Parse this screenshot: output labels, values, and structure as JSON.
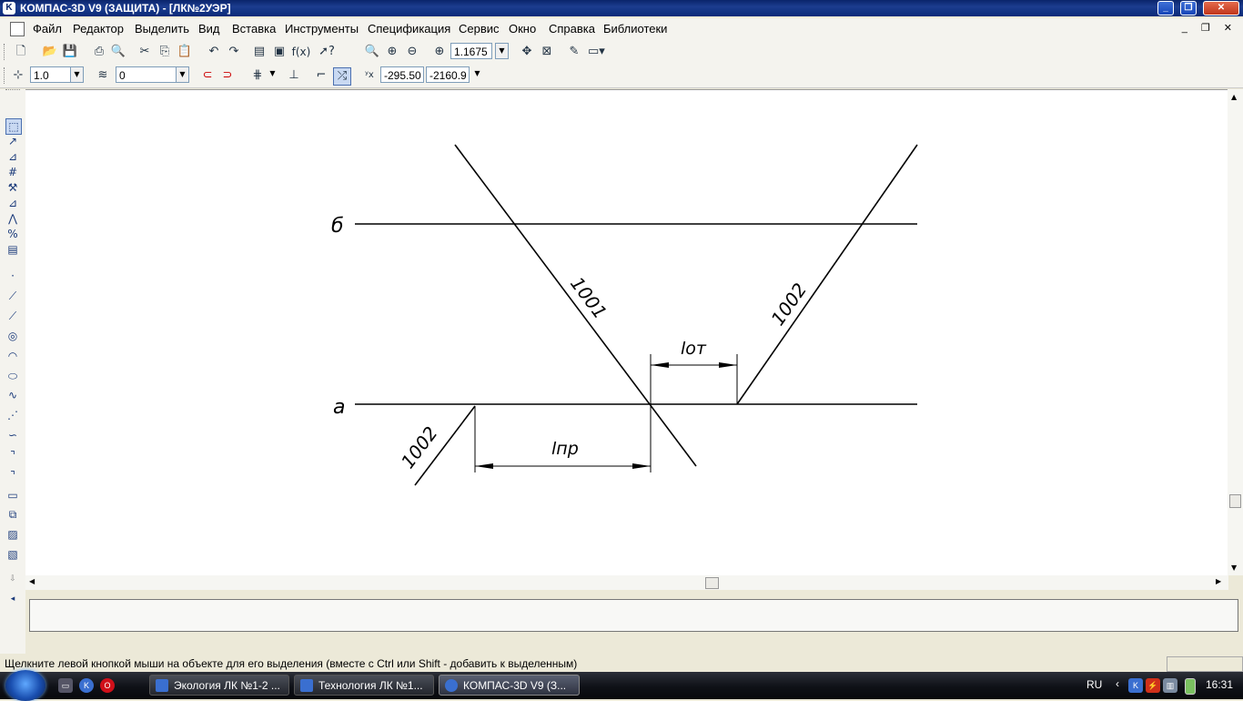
{
  "window": {
    "title": "КОМПАС-3D V9 (ЗАЩИТА) - [ЛК№2УЭР]",
    "app_icon": "kompas-logo-icon",
    "buttons": [
      "minimize-icon",
      "restore-icon",
      "close-icon"
    ]
  },
  "menu": {
    "items": [
      "Файл",
      "Редактор",
      "Выделить",
      "Вид",
      "Вставка",
      "Инструменты",
      "Спецификация",
      "Сервис",
      "Окно",
      "Справка",
      "Библиотеки"
    ]
  },
  "toolbar1": {
    "icons": [
      "new-file-icon",
      "open-file-icon",
      "save-icon",
      "print-icon",
      "print-preview-icon",
      "cut-icon",
      "copy-icon",
      "paste-icon",
      "undo-icon",
      "redo-icon",
      "manager-icon",
      "variables-icon",
      "formula-icon",
      "help-pointer-icon",
      "zoom-window-icon",
      "zoom-in-icon",
      "zoom-out-icon",
      "zoom-scale-icon",
      "pan-icon",
      "zoom-fit-icon",
      "refresh-icon",
      "display-icon"
    ],
    "zoom_value": "1.1675"
  },
  "toolbar2": {
    "step_value": "1.0",
    "layer_value": "0",
    "coord_x": "-295.50",
    "coord_y": "-2160.9"
  },
  "lefttools": {
    "icons": [
      "select-icon",
      "dimension-icon",
      "symbol-icon",
      "table-icon",
      "edit-icon",
      "parametrize-icon",
      "measure-icon",
      "selection-icon",
      "specification-icon",
      "point-icon",
      "aux-line-icon",
      "segment-icon",
      "circle-icon",
      "arc-icon",
      "ellipse-icon",
      "spline-icon",
      "polyline-icon",
      "bezier-icon",
      "chamfer-icon",
      "fillet-icon",
      "rectangle-icon",
      "macro-icon",
      "hatch-icon",
      "fill-icon"
    ]
  },
  "drawing": {
    "label_b": "б",
    "label_a": "а",
    "line_1001": "1001",
    "line_1002_top": "1002",
    "line_1002_bottom": "1002",
    "dim_top": "lот",
    "dim_bottom": "lпр"
  },
  "statusbar": {
    "text": "Щелкните левой кнопкой мыши на объекте для его выделения (вместе с Ctrl или Shift - добавить к выделенным)"
  },
  "taskbar": {
    "start": "start-orb-icon",
    "quicklaunch": [
      "show-desktop-icon",
      "kompas-quick-icon",
      "opera-icon"
    ],
    "tasks": [
      {
        "label": "Экология ЛК №1-2 ...",
        "active": false
      },
      {
        "label": "Технология ЛК №1...",
        "active": false
      },
      {
        "label": "КОМПАС-3D V9 (З...",
        "active": true
      }
    ],
    "lang": "RU",
    "tray_icons": [
      "arrow-left-icon",
      "kompas-tray-icon",
      "antivirus-icon",
      "network-icon",
      "battery-icon"
    ],
    "time": "16:31"
  }
}
